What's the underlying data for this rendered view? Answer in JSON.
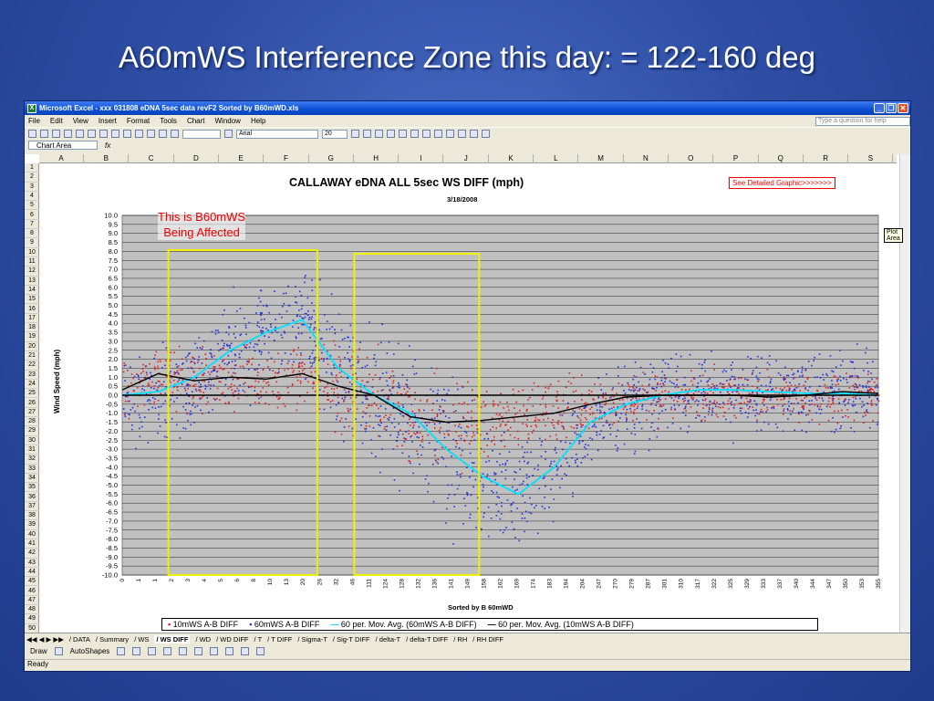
{
  "slide": {
    "title": "A60mWS Interference Zone this day: = 122-160 deg"
  },
  "window": {
    "title": "Microsoft Excel - xxx 031808 eDNA 5sec data revF2 Sorted by B60mWD.xls"
  },
  "menu": {
    "items": [
      "File",
      "Edit",
      "View",
      "Insert",
      "Format",
      "Tools",
      "Chart",
      "Window",
      "Help"
    ],
    "ask_placeholder": "Type a question for help"
  },
  "toolbar": {
    "font": "Arial",
    "size": "20"
  },
  "namebox": {
    "value": "Chart Area",
    "fx": "fx"
  },
  "columns": [
    "A",
    "B",
    "C",
    "D",
    "E",
    "F",
    "G",
    "H",
    "I",
    "J",
    "K",
    "L",
    "M",
    "N",
    "O",
    "P",
    "Q",
    "R",
    "S"
  ],
  "rows": [
    "1",
    "2",
    "3",
    "4",
    "5",
    "6",
    "7",
    "8",
    "9",
    "10",
    "11",
    "12",
    "13",
    "14",
    "15",
    "16",
    "17",
    "18",
    "19",
    "20",
    "21",
    "22",
    "23",
    "24",
    "25",
    "26",
    "27",
    "28",
    "29",
    "30",
    "31",
    "32",
    "33",
    "34",
    "35",
    "36",
    "37",
    "38",
    "39",
    "40",
    "41",
    "42",
    "43",
    "44",
    "45",
    "46",
    "47",
    "48",
    "49",
    "50"
  ],
  "chart": {
    "title": "CALLAWAY eDNA ALL 5sec WS DIFF (mph)",
    "date": "3/18/2008",
    "detail_button": "See Detailed Graphic>>>>>>>",
    "tooltip": "Plot Area",
    "annotation_line1": "This is B60mWS",
    "annotation_line2": "Being Affected",
    "colors": {
      "red": "#e02020",
      "blue": "#2030e0",
      "cyan": "#00e0ff",
      "black": "#000000",
      "plot_bg": "#c0c0c0",
      "box": "#f0f000"
    }
  },
  "chart_data": {
    "type": "scatter",
    "title": "CALLAWAY eDNA ALL 5sec WS DIFF (mph)",
    "subtitle": "3/18/2008",
    "xlabel": "Sorted by B 60mWD",
    "ylabel": "Wind Speed (mph)",
    "ylim": [
      -10.0,
      10.0
    ],
    "yticks": [
      "10.0",
      "9.5",
      "9.0",
      "8.5",
      "8.0",
      "7.5",
      "7.0",
      "6.5",
      "6.0",
      "5.5",
      "5.0",
      "4.5",
      "4.0",
      "3.5",
      "3.0",
      "2.5",
      "2.0",
      "1.5",
      "1.0",
      "0.5",
      "0.0",
      "-0.5",
      "-1.0",
      "-1.5",
      "-2.0",
      "-2.5",
      "-3.0",
      "-3.5",
      "-4.0",
      "-4.5",
      "-5.0",
      "-5.5",
      "-6.0",
      "-6.5",
      "-7.0",
      "-7.5",
      "-8.0",
      "-8.5",
      "-9.0",
      "-9.5",
      "-10.0"
    ],
    "xticks": [
      "0",
      "1",
      "1",
      "2",
      "3",
      "4",
      "5",
      "6",
      "8",
      "10",
      "13",
      "20",
      "26",
      "32",
      "46",
      "111",
      "124",
      "128",
      "132",
      "136",
      "141",
      "149",
      "158",
      "162",
      "169",
      "174",
      "183",
      "194",
      "204",
      "247",
      "270",
      "279",
      "287",
      "301",
      "310",
      "317",
      "322",
      "325",
      "329",
      "333",
      "337",
      "340",
      "344",
      "347",
      "350",
      "353",
      "355"
    ],
    "legend": [
      "10mWS A-B DIFF",
      "60mWS A-B DIFF",
      "60 per. Mov. Avg. (60mWS A-B DIFF)",
      "60 per. Mov. Avg. (10mWS A-B DIFF)"
    ],
    "grid": true,
    "legend_position": "bottom",
    "series": [
      {
        "name": "10mWS A-B DIFF",
        "color": "#e02020"
      },
      {
        "name": "60mWS A-B DIFF",
        "color": "#2030e0"
      },
      {
        "name": "60 per. Mov. Avg. (60mWS A-B DIFF)",
        "color": "#00e0ff",
        "values": [
          0.0,
          0.2,
          1.0,
          2.5,
          3.5,
          4.2,
          1.5,
          0.0,
          -1.0,
          -3.0,
          -4.5,
          -5.5,
          -4.0,
          -1.5,
          -0.5,
          0.0,
          0.3,
          0.3,
          0.2,
          0.1,
          0.1,
          0.0
        ]
      },
      {
        "name": "60 per. Mov. Avg. (10mWS A-B DIFF)",
        "color": "#000000",
        "values": [
          0.3,
          1.2,
          0.8,
          1.0,
          0.9,
          1.2,
          0.5,
          0.0,
          -1.2,
          -1.5,
          -1.4,
          -1.2,
          -1.0,
          -0.5,
          -0.1,
          0.0,
          0.0,
          0.0,
          -0.1,
          0.0,
          0.2,
          0.1
        ]
      }
    ]
  },
  "sheets": {
    "tabs": [
      "DATA",
      "Summary",
      "WS",
      "WS DIFF",
      "WD",
      "WD DIFF",
      "T",
      "T DIFF",
      "Sigma-T",
      "Sig-T DIFF",
      "delta-T",
      "delta-T DIFF",
      "RH",
      "RH DIFF"
    ],
    "active": "WS DIFF"
  },
  "drawing": {
    "draw": "Draw",
    "autoshapes": "AutoShapes"
  },
  "status": {
    "text": "Ready"
  }
}
